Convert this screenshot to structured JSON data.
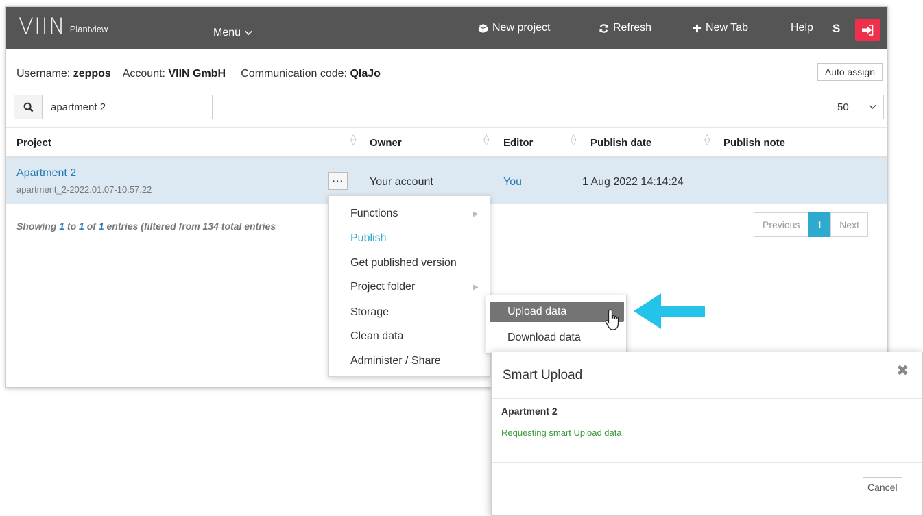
{
  "navbar": {
    "logo_mark": "VIIN",
    "logo_sub": "Plantview",
    "menu_label": "Menu",
    "new_project": "New project",
    "refresh": "Refresh",
    "new_tab": "New Tab",
    "help": "Help",
    "user_initial": "S"
  },
  "info": {
    "username_label": "Username:",
    "username": "zeppos",
    "account_label": "Account:",
    "account": "VIIN GmbH",
    "code_label": "Communication code:",
    "code": "QlaJo",
    "auto_assign": "Auto assign"
  },
  "search": {
    "value": "apartment 2"
  },
  "page_size": "50",
  "table": {
    "columns": [
      "Project",
      "Owner",
      "Editor",
      "Publish date",
      "Publish note"
    ],
    "row": {
      "project": "Apartment 2",
      "project_id": "apartment_2-2022.01.07-10.57.22",
      "owner": "Your account",
      "editor": "You",
      "publish_date": "1 Aug 2022 14:14:24",
      "publish_note": ""
    }
  },
  "footer": {
    "showing": "Showing",
    "from": "1",
    "to_word": "to",
    "to": "1",
    "of_word": "of",
    "total": "1",
    "rest": "entries (filtered from 134 total entries"
  },
  "pager": {
    "previous": "Previous",
    "page": "1",
    "next": "Next"
  },
  "context_menu": {
    "items": [
      "Functions",
      "Publish",
      "Get published version",
      "Project folder",
      "Storage",
      "Clean data",
      "Administer / Share"
    ]
  },
  "submenu": {
    "upload": "Upload data",
    "download": "Download data"
  },
  "modal": {
    "title": "Smart Upload",
    "project": "Apartment 2",
    "message": "Requesting smart Upload data.",
    "cancel": "Cancel"
  },
  "colors": {
    "navbar": "#555555",
    "logout": "#f0304a",
    "accent": "#2eaacf",
    "link": "#2a7ab8",
    "row_highlight": "#dde9f2",
    "success": "#3a9a3a",
    "arrow": "#23c3ea"
  }
}
